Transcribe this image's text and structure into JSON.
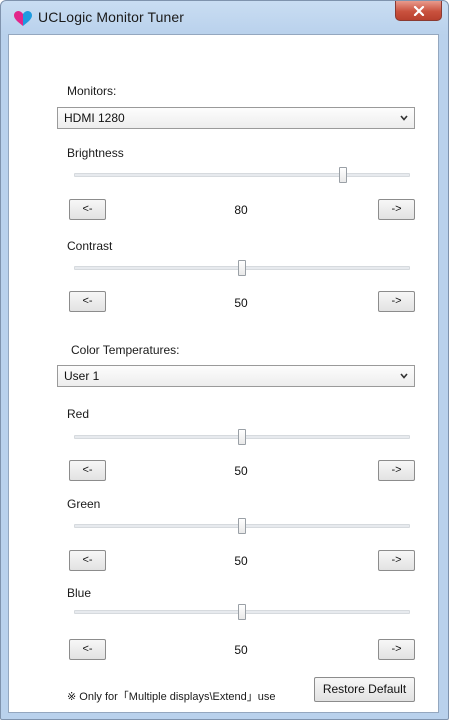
{
  "window": {
    "title": "UCLogic Monitor Tuner",
    "close_glyph": "x"
  },
  "monitors": {
    "label": "Monitors:",
    "selected": "HDMI 1280"
  },
  "brightness": {
    "label": "Brightness",
    "value": "80",
    "level": 0.8,
    "dec_label": "<-",
    "inc_label": "->"
  },
  "contrast": {
    "label": "Contrast",
    "value": "50",
    "level": 0.5,
    "dec_label": "<-",
    "inc_label": "->"
  },
  "color_temperatures": {
    "label": "Color Temperatures:",
    "selected": "User 1"
  },
  "red": {
    "label": "Red",
    "value": "50",
    "level": 0.5,
    "dec_label": "<-",
    "inc_label": "->"
  },
  "green": {
    "label": "Green",
    "value": "50",
    "level": 0.5,
    "dec_label": "<-",
    "inc_label": "->"
  },
  "blue": {
    "label": "Blue",
    "value": "50",
    "level": 0.5,
    "dec_label": "<-",
    "inc_label": "->"
  },
  "footer": {
    "note": "※ Only for「Multiple displays\\Extend」use",
    "restore_label": "Restore Default"
  },
  "colors": {
    "title_bar": "#b9d1ec",
    "close_button": "#c9513e",
    "logo_magenta": "#e2268a",
    "logo_cyan": "#1e9be0"
  },
  "icons": {
    "app": "uclogic-logo-icon",
    "close": "close-icon",
    "dropdown": "chevron-down-icon"
  }
}
